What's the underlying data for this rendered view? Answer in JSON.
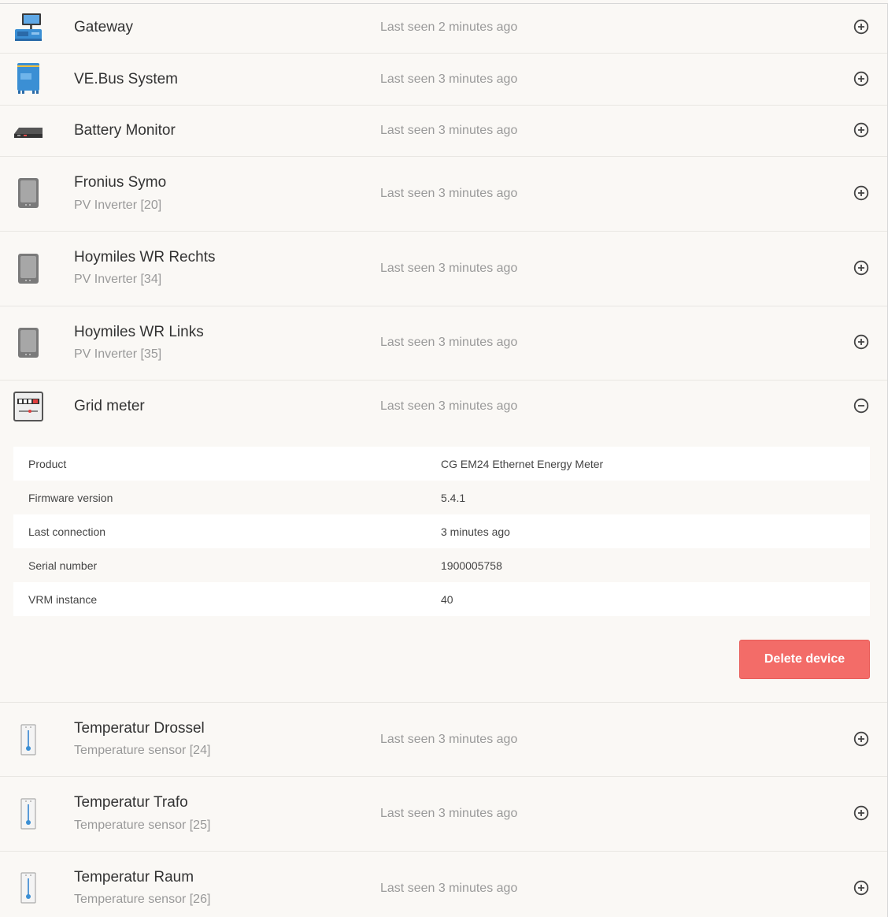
{
  "devices": [
    {
      "name": "Gateway",
      "sub": "",
      "seen": "Last seen 2 minutes ago",
      "icon": "gateway-icon",
      "expanded": false
    },
    {
      "name": "VE.Bus System",
      "sub": "",
      "seen": "Last seen 3 minutes ago",
      "icon": "inverter-charger-icon",
      "expanded": false
    },
    {
      "name": "Battery Monitor",
      "sub": "",
      "seen": "Last seen 3 minutes ago",
      "icon": "battery-monitor-icon",
      "expanded": false
    },
    {
      "name": "Fronius Symo",
      "sub": "PV Inverter [20]",
      "seen": "Last seen 3 minutes ago",
      "icon": "pv-inverter-icon",
      "expanded": false
    },
    {
      "name": "Hoymiles WR Rechts",
      "sub": "PV Inverter [34]",
      "seen": "Last seen 3 minutes ago",
      "icon": "pv-inverter-icon",
      "expanded": false
    },
    {
      "name": "Hoymiles WR Links",
      "sub": "PV Inverter [35]",
      "seen": "Last seen 3 minutes ago",
      "icon": "pv-inverter-icon",
      "expanded": false
    },
    {
      "name": "Grid meter",
      "sub": "",
      "seen": "Last seen 3 minutes ago",
      "icon": "energy-meter-icon",
      "expanded": true
    },
    {
      "name": "Temperatur Drossel",
      "sub": "Temperature sensor [24]",
      "seen": "Last seen 3 minutes ago",
      "icon": "thermometer-icon",
      "expanded": false
    },
    {
      "name": "Temperatur Trafo",
      "sub": "Temperature sensor [25]",
      "seen": "Last seen 3 minutes ago",
      "icon": "thermometer-icon",
      "expanded": false
    },
    {
      "name": "Temperatur Raum",
      "sub": "Temperature sensor [26]",
      "seen": "Last seen 3 minutes ago",
      "icon": "thermometer-icon",
      "expanded": false
    }
  ],
  "details": [
    {
      "label": "Product",
      "value": "CG EM24 Ethernet Energy Meter"
    },
    {
      "label": "Firmware version",
      "value": "5.4.1"
    },
    {
      "label": "Last connection",
      "value": "3 minutes ago"
    },
    {
      "label": "Serial number",
      "value": "1900005758"
    },
    {
      "label": "VRM instance",
      "value": "40"
    }
  ],
  "delete_label": "Delete device",
  "colors": {
    "accent": "#f36c68",
    "victron_blue": "#4a90d9",
    "muted_text": "#999999"
  }
}
